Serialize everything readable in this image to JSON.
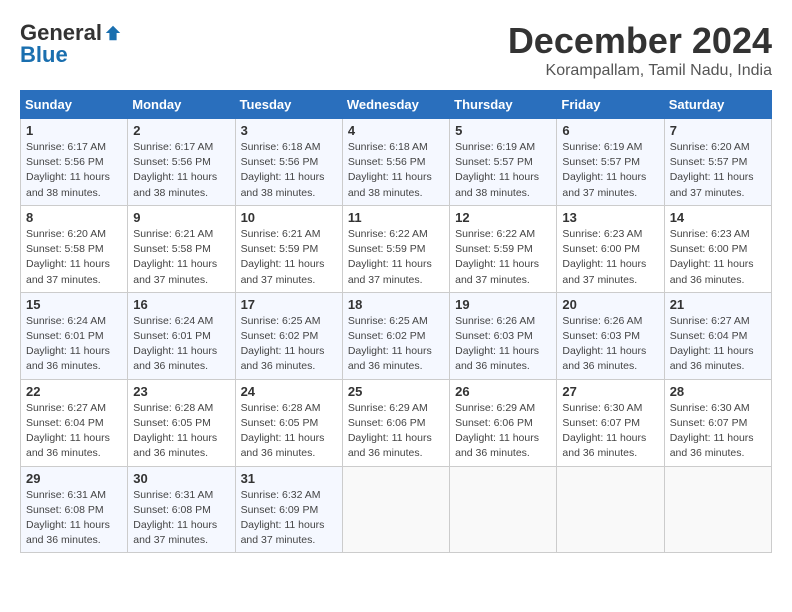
{
  "header": {
    "logo_general": "General",
    "logo_blue": "Blue",
    "month_title": "December 2024",
    "location": "Korampallam, Tamil Nadu, India"
  },
  "days_of_week": [
    "Sunday",
    "Monday",
    "Tuesday",
    "Wednesday",
    "Thursday",
    "Friday",
    "Saturday"
  ],
  "weeks": [
    [
      {
        "day": "1",
        "sunrise": "6:17 AM",
        "sunset": "5:56 PM",
        "daylight": "11 hours and 38 minutes."
      },
      {
        "day": "2",
        "sunrise": "6:17 AM",
        "sunset": "5:56 PM",
        "daylight": "11 hours and 38 minutes."
      },
      {
        "day": "3",
        "sunrise": "6:18 AM",
        "sunset": "5:56 PM",
        "daylight": "11 hours and 38 minutes."
      },
      {
        "day": "4",
        "sunrise": "6:18 AM",
        "sunset": "5:56 PM",
        "daylight": "11 hours and 38 minutes."
      },
      {
        "day": "5",
        "sunrise": "6:19 AM",
        "sunset": "5:57 PM",
        "daylight": "11 hours and 38 minutes."
      },
      {
        "day": "6",
        "sunrise": "6:19 AM",
        "sunset": "5:57 PM",
        "daylight": "11 hours and 37 minutes."
      },
      {
        "day": "7",
        "sunrise": "6:20 AM",
        "sunset": "5:57 PM",
        "daylight": "11 hours and 37 minutes."
      }
    ],
    [
      {
        "day": "8",
        "sunrise": "6:20 AM",
        "sunset": "5:58 PM",
        "daylight": "11 hours and 37 minutes."
      },
      {
        "day": "9",
        "sunrise": "6:21 AM",
        "sunset": "5:58 PM",
        "daylight": "11 hours and 37 minutes."
      },
      {
        "day": "10",
        "sunrise": "6:21 AM",
        "sunset": "5:59 PM",
        "daylight": "11 hours and 37 minutes."
      },
      {
        "day": "11",
        "sunrise": "6:22 AM",
        "sunset": "5:59 PM",
        "daylight": "11 hours and 37 minutes."
      },
      {
        "day": "12",
        "sunrise": "6:22 AM",
        "sunset": "5:59 PM",
        "daylight": "11 hours and 37 minutes."
      },
      {
        "day": "13",
        "sunrise": "6:23 AM",
        "sunset": "6:00 PM",
        "daylight": "11 hours and 37 minutes."
      },
      {
        "day": "14",
        "sunrise": "6:23 AM",
        "sunset": "6:00 PM",
        "daylight": "11 hours and 36 minutes."
      }
    ],
    [
      {
        "day": "15",
        "sunrise": "6:24 AM",
        "sunset": "6:01 PM",
        "daylight": "11 hours and 36 minutes."
      },
      {
        "day": "16",
        "sunrise": "6:24 AM",
        "sunset": "6:01 PM",
        "daylight": "11 hours and 36 minutes."
      },
      {
        "day": "17",
        "sunrise": "6:25 AM",
        "sunset": "6:02 PM",
        "daylight": "11 hours and 36 minutes."
      },
      {
        "day": "18",
        "sunrise": "6:25 AM",
        "sunset": "6:02 PM",
        "daylight": "11 hours and 36 minutes."
      },
      {
        "day": "19",
        "sunrise": "6:26 AM",
        "sunset": "6:03 PM",
        "daylight": "11 hours and 36 minutes."
      },
      {
        "day": "20",
        "sunrise": "6:26 AM",
        "sunset": "6:03 PM",
        "daylight": "11 hours and 36 minutes."
      },
      {
        "day": "21",
        "sunrise": "6:27 AM",
        "sunset": "6:04 PM",
        "daylight": "11 hours and 36 minutes."
      }
    ],
    [
      {
        "day": "22",
        "sunrise": "6:27 AM",
        "sunset": "6:04 PM",
        "daylight": "11 hours and 36 minutes."
      },
      {
        "day": "23",
        "sunrise": "6:28 AM",
        "sunset": "6:05 PM",
        "daylight": "11 hours and 36 minutes."
      },
      {
        "day": "24",
        "sunrise": "6:28 AM",
        "sunset": "6:05 PM",
        "daylight": "11 hours and 36 minutes."
      },
      {
        "day": "25",
        "sunrise": "6:29 AM",
        "sunset": "6:06 PM",
        "daylight": "11 hours and 36 minutes."
      },
      {
        "day": "26",
        "sunrise": "6:29 AM",
        "sunset": "6:06 PM",
        "daylight": "11 hours and 36 minutes."
      },
      {
        "day": "27",
        "sunrise": "6:30 AM",
        "sunset": "6:07 PM",
        "daylight": "11 hours and 36 minutes."
      },
      {
        "day": "28",
        "sunrise": "6:30 AM",
        "sunset": "6:07 PM",
        "daylight": "11 hours and 36 minutes."
      }
    ],
    [
      {
        "day": "29",
        "sunrise": "6:31 AM",
        "sunset": "6:08 PM",
        "daylight": "11 hours and 36 minutes."
      },
      {
        "day": "30",
        "sunrise": "6:31 AM",
        "sunset": "6:08 PM",
        "daylight": "11 hours and 37 minutes."
      },
      {
        "day": "31",
        "sunrise": "6:32 AM",
        "sunset": "6:09 PM",
        "daylight": "11 hours and 37 minutes."
      },
      null,
      null,
      null,
      null
    ]
  ]
}
